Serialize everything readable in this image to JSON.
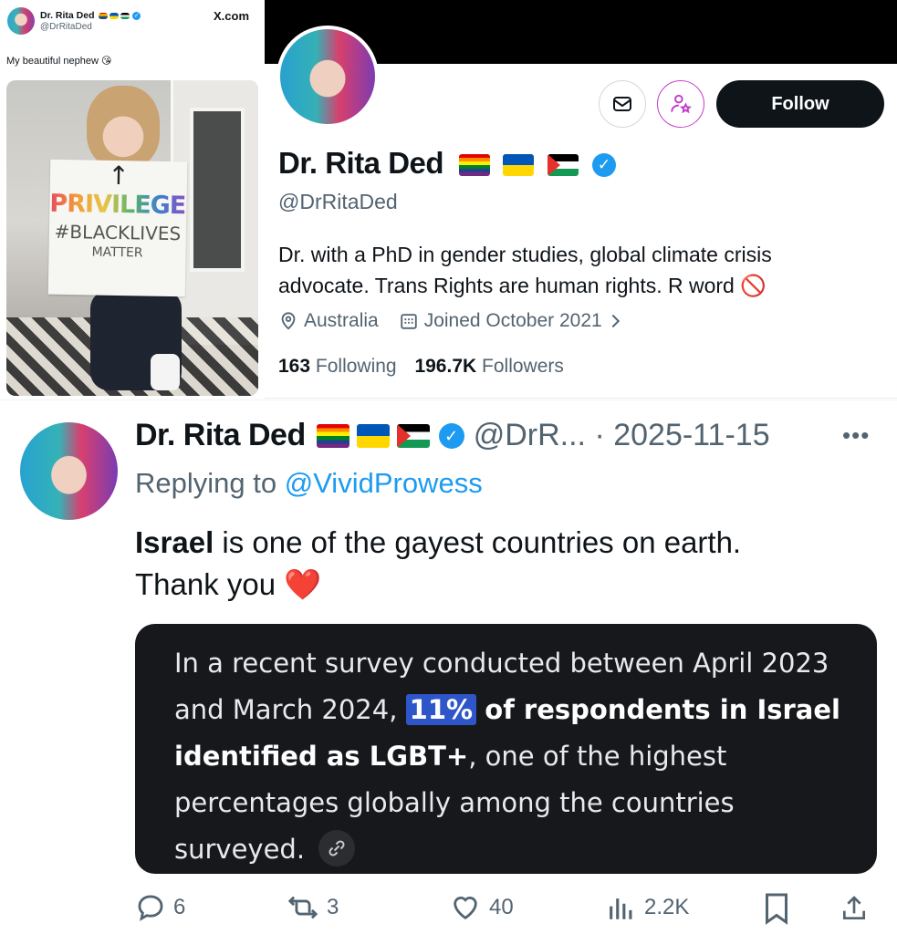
{
  "embed": {
    "name": "Dr. Rita Ded",
    "handle": "@DrRitaDed",
    "brand": "X.com",
    "text": "My beautiful nephew 😘",
    "sign": {
      "arrow": "↑",
      "word": "PRIVILEGED",
      "line1": "#BLACKLIVES",
      "line2": "MATTER"
    }
  },
  "profile": {
    "name": "Dr. Rita Ded",
    "handle": "@DrRitaDed",
    "bio": "Dr. with a PhD in gender studies, global climate crisis advocate. Trans Rights are human rights. R word 🚫",
    "location": "Australia",
    "joined": "Joined October 2021",
    "following_count": "163",
    "following_label": "Following",
    "followers_count": "196.7K",
    "followers_label": "Followers",
    "follow_label": "Follow",
    "verified": true
  },
  "tweet": {
    "name": "Dr. Rita Ded",
    "handle_date": "@DrR... · 2025-11-15",
    "more": "•••",
    "replying_prefix": "Replying to",
    "replying_to": "@VividProwess",
    "body_bold": "Israel",
    "body_rest": " is one of the  gayest countries on earth.",
    "body_line2": "Thank you",
    "heart": "❤️",
    "card": {
      "text_a": "In a recent survey conducted between April 2023 and March 2024,",
      "highlight": "11%",
      "text_bold": "of respondents in Israel identified as LGBT+",
      "text_b": ", one of the highest percentages globally among the countries surveyed."
    },
    "actions": {
      "replies": "6",
      "reposts": "3",
      "likes": "40",
      "views": "2.2K"
    }
  },
  "colors": {
    "accent": "#1d9bf0",
    "text": "#0f1419",
    "secondary": "#536471",
    "card_bg": "#17181c",
    "highlight": "#2e56c8",
    "subscribe": "#c13fc9"
  }
}
